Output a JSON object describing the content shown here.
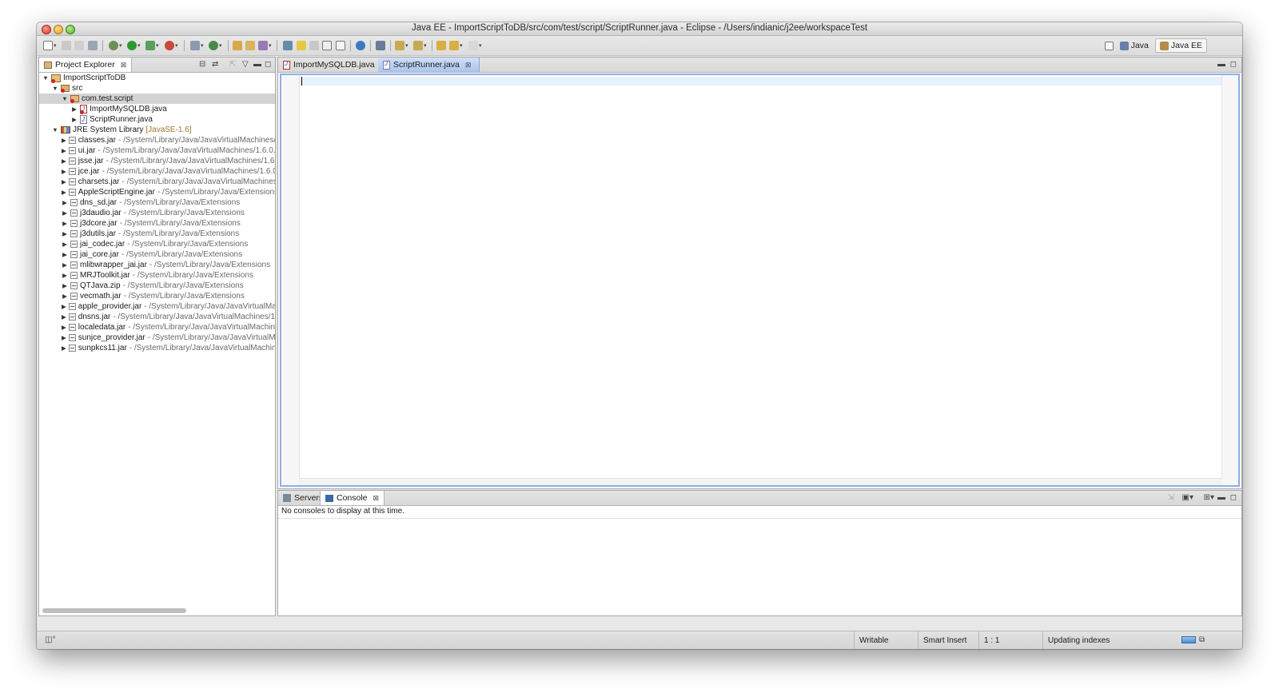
{
  "window": {
    "title": "Java EE - ImportScriptToDB/src/com/test/script/ScriptRunner.java - Eclipse - /Users/indianic/j2ee/workspaceTest"
  },
  "toolbar": {
    "icons": [
      "new-wizard-icon",
      "save-icon",
      "save-all-icon",
      "print-icon",
      "debug-icon",
      "run-icon",
      "run-coverage-icon",
      "external-tools-icon",
      "new-server-icon",
      "new-class-icon",
      "open-type-icon",
      "open-task-icon",
      "search-icon",
      "next-annotation-icon",
      "toggle-mark-occurrences-icon",
      "toggle-breadcrumb-icon",
      "block-selection-icon",
      "show-whitespace-icon",
      "web-browser-icon",
      "launch-icon",
      "next-annotation-down-icon",
      "prev-annotation-icon",
      "back-icon",
      "forward-icon"
    ]
  },
  "perspectives": {
    "items": [
      {
        "label": "Java",
        "active": false
      },
      {
        "label": "Java EE",
        "active": true
      }
    ]
  },
  "project_explorer": {
    "tab_label": "Project Explorer",
    "tree": [
      {
        "level": 0,
        "twisty": "open",
        "icon": "project",
        "name": "ImportScriptToDB",
        "path": "",
        "decoration": "",
        "error": true
      },
      {
        "level": 1,
        "twisty": "open",
        "icon": "src",
        "name": "src",
        "path": "",
        "decoration": "",
        "error": true
      },
      {
        "level": 2,
        "twisty": "open",
        "icon": "package",
        "name": "com.test.script",
        "path": "",
        "decoration": "",
        "error": true,
        "selected": true
      },
      {
        "level": 3,
        "twisty": "closed",
        "icon": "java-err",
        "name": "ImportMySQLDB.java",
        "path": "",
        "decoration": "",
        "error": true
      },
      {
        "level": 3,
        "twisty": "closed",
        "icon": "java",
        "name": "ScriptRunner.java",
        "path": "",
        "decoration": ""
      },
      {
        "level": 1,
        "twisty": "open",
        "icon": "lib",
        "name": "JRE System Library",
        "path": "",
        "decoration": " [JavaSE-1.6]"
      },
      {
        "level": 2,
        "twisty": "closed",
        "icon": "jar",
        "name": "classes.jar",
        "path": " - /System/Library/Java/JavaVirtualMachines/1.",
        "decoration": ""
      },
      {
        "level": 2,
        "twisty": "closed",
        "icon": "jar",
        "name": "ui.jar",
        "path": " - /System/Library/Java/JavaVirtualMachines/1.6.0.jd",
        "decoration": ""
      },
      {
        "level": 2,
        "twisty": "closed",
        "icon": "jar",
        "name": "jsse.jar",
        "path": " - /System/Library/Java/JavaVirtualMachines/1.6.0",
        "decoration": ""
      },
      {
        "level": 2,
        "twisty": "closed",
        "icon": "jar",
        "name": "jce.jar",
        "path": " - /System/Library/Java/JavaVirtualMachines/1.6.0.",
        "decoration": ""
      },
      {
        "level": 2,
        "twisty": "closed",
        "icon": "jar",
        "name": "charsets.jar",
        "path": " - /System/Library/Java/JavaVirtualMachines/1",
        "decoration": ""
      },
      {
        "level": 2,
        "twisty": "closed",
        "icon": "jar",
        "name": "AppleScriptEngine.jar",
        "path": " - /System/Library/Java/Extensions",
        "decoration": ""
      },
      {
        "level": 2,
        "twisty": "closed",
        "icon": "jar",
        "name": "dns_sd.jar",
        "path": " - /System/Library/Java/Extensions",
        "decoration": ""
      },
      {
        "level": 2,
        "twisty": "closed",
        "icon": "jar",
        "name": "j3daudio.jar",
        "path": " - /System/Library/Java/Extensions",
        "decoration": ""
      },
      {
        "level": 2,
        "twisty": "closed",
        "icon": "jar",
        "name": "j3dcore.jar",
        "path": " - /System/Library/Java/Extensions",
        "decoration": ""
      },
      {
        "level": 2,
        "twisty": "closed",
        "icon": "jar",
        "name": "j3dutils.jar",
        "path": " - /System/Library/Java/Extensions",
        "decoration": ""
      },
      {
        "level": 2,
        "twisty": "closed",
        "icon": "jar",
        "name": "jai_codec.jar",
        "path": " - /System/Library/Java/Extensions",
        "decoration": ""
      },
      {
        "level": 2,
        "twisty": "closed",
        "icon": "jar",
        "name": "jai_core.jar",
        "path": " - /System/Library/Java/Extensions",
        "decoration": ""
      },
      {
        "level": 2,
        "twisty": "closed",
        "icon": "jar",
        "name": "mlibwrapper_jai.jar",
        "path": " - /System/Library/Java/Extensions",
        "decoration": ""
      },
      {
        "level": 2,
        "twisty": "closed",
        "icon": "jar",
        "name": "MRJToolkit.jar",
        "path": " - /System/Library/Java/Extensions",
        "decoration": ""
      },
      {
        "level": 2,
        "twisty": "closed",
        "icon": "jar",
        "name": "QTJava.zip",
        "path": " - /System/Library/Java/Extensions",
        "decoration": ""
      },
      {
        "level": 2,
        "twisty": "closed",
        "icon": "jar",
        "name": "vecmath.jar",
        "path": " - /System/Library/Java/Extensions",
        "decoration": ""
      },
      {
        "level": 2,
        "twisty": "closed",
        "icon": "jar",
        "name": "apple_provider.jar",
        "path": " - /System/Library/Java/JavaVirtualMacl",
        "decoration": ""
      },
      {
        "level": 2,
        "twisty": "closed",
        "icon": "jar",
        "name": "dnsns.jar",
        "path": " - /System/Library/Java/JavaVirtualMachines/1.6",
        "decoration": ""
      },
      {
        "level": 2,
        "twisty": "closed",
        "icon": "jar",
        "name": "localedata.jar",
        "path": " - /System/Library/Java/JavaVirtualMachines",
        "decoration": ""
      },
      {
        "level": 2,
        "twisty": "closed",
        "icon": "jar",
        "name": "sunjce_provider.jar",
        "path": " - /System/Library/Java/JavaVirtualMac",
        "decoration": ""
      },
      {
        "level": 2,
        "twisty": "closed",
        "icon": "jar",
        "name": "sunpkcs11.jar",
        "path": " - /System/Library/Java/JavaVirtualMachine",
        "decoration": ""
      }
    ]
  },
  "editor": {
    "tabs": [
      {
        "label": "ImportMySQLDB.java",
        "active": false,
        "error": true
      },
      {
        "label": "ScriptRunner.java",
        "active": true,
        "error": false
      }
    ]
  },
  "bottom_panel": {
    "tabs": [
      {
        "label": "Servers",
        "active": false
      },
      {
        "label": "Console",
        "active": true
      }
    ],
    "console_message": "No consoles to display at this time."
  },
  "status_bar": {
    "writable": "Writable",
    "insert_mode": "Smart Insert",
    "cursor_position": "1 : 1",
    "progress_text": "Updating indexes"
  }
}
